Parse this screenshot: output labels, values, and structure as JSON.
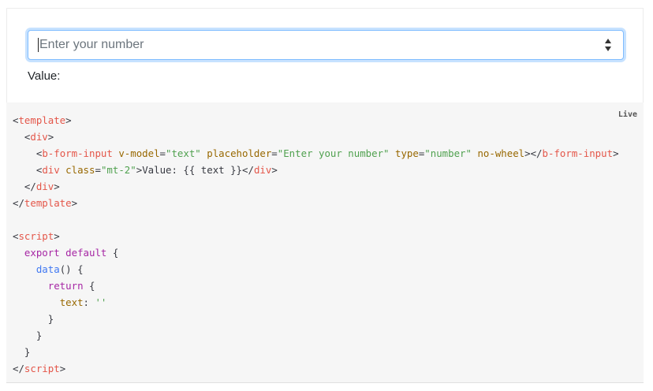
{
  "preview": {
    "input_placeholder": "Enter your number",
    "value_label": "Value:"
  },
  "code": {
    "live_badge": "Live",
    "lines": [
      [
        [
          "punc",
          "<"
        ],
        [
          "tag",
          "template"
        ],
        [
          "punc",
          ">"
        ]
      ],
      [
        [
          "txt",
          "  "
        ],
        [
          "punc",
          "<"
        ],
        [
          "tag",
          "div"
        ],
        [
          "punc",
          ">"
        ]
      ],
      [
        [
          "txt",
          "    "
        ],
        [
          "punc",
          "<"
        ],
        [
          "tag",
          "b-form-input"
        ],
        [
          "txt",
          " "
        ],
        [
          "attr",
          "v-model"
        ],
        [
          "punc",
          "="
        ],
        [
          "str",
          "\"text\""
        ],
        [
          "txt",
          " "
        ],
        [
          "attr",
          "placeholder"
        ],
        [
          "punc",
          "="
        ],
        [
          "str",
          "\"Enter your number\""
        ],
        [
          "txt",
          " "
        ],
        [
          "attr",
          "type"
        ],
        [
          "punc",
          "="
        ],
        [
          "str",
          "\"number\""
        ],
        [
          "txt",
          " "
        ],
        [
          "attr",
          "no-wheel"
        ],
        [
          "punc",
          "></"
        ],
        [
          "tag",
          "b-form-input"
        ],
        [
          "punc",
          ">"
        ]
      ],
      [
        [
          "txt",
          "    "
        ],
        [
          "punc",
          "<"
        ],
        [
          "tag",
          "div"
        ],
        [
          "txt",
          " "
        ],
        [
          "attr",
          "class"
        ],
        [
          "punc",
          "="
        ],
        [
          "str",
          "\"mt-2\""
        ],
        [
          "punc",
          ">"
        ],
        [
          "txt",
          "Value: {{ text }}"
        ],
        [
          "punc",
          "</"
        ],
        [
          "tag",
          "div"
        ],
        [
          "punc",
          ">"
        ]
      ],
      [
        [
          "txt",
          "  "
        ],
        [
          "punc",
          "</"
        ],
        [
          "tag",
          "div"
        ],
        [
          "punc",
          ">"
        ]
      ],
      [
        [
          "punc",
          "</"
        ],
        [
          "tag",
          "template"
        ],
        [
          "punc",
          ">"
        ]
      ],
      [
        [
          "txt",
          ""
        ]
      ],
      [
        [
          "punc",
          "<"
        ],
        [
          "tag",
          "script"
        ],
        [
          "punc",
          ">"
        ]
      ],
      [
        [
          "txt",
          "  "
        ],
        [
          "kw",
          "export"
        ],
        [
          "txt",
          " "
        ],
        [
          "kw",
          "default"
        ],
        [
          "txt",
          " {"
        ]
      ],
      [
        [
          "txt",
          "    "
        ],
        [
          "fn",
          "data"
        ],
        [
          "txt",
          "() {"
        ]
      ],
      [
        [
          "txt",
          "      "
        ],
        [
          "kw",
          "return"
        ],
        [
          "txt",
          " {"
        ]
      ],
      [
        [
          "txt",
          "        "
        ],
        [
          "attr",
          "text"
        ],
        [
          "txt",
          ": "
        ],
        [
          "str",
          "''"
        ]
      ],
      [
        [
          "txt",
          "      }"
        ]
      ],
      [
        [
          "txt",
          "    }"
        ]
      ],
      [
        [
          "txt",
          "  }"
        ]
      ],
      [
        [
          "punc",
          "</"
        ],
        [
          "tag",
          "script"
        ],
        [
          "punc",
          ">"
        ]
      ]
    ]
  }
}
